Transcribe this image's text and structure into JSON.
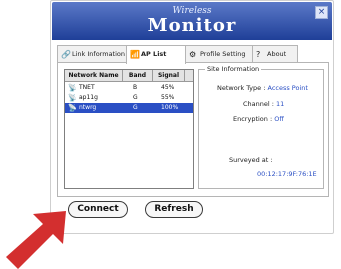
{
  "window": {
    "title_small": "Wireless",
    "title_large": "Monitor",
    "close_glyph": "×"
  },
  "tabs": [
    {
      "label": "Link Information",
      "icon": "link-icon"
    },
    {
      "label": "AP List",
      "icon": "ap-list-icon",
      "active": true
    },
    {
      "label": "Profile Setting",
      "icon": "profile-icon"
    },
    {
      "label": "About",
      "icon": "about-icon"
    }
  ],
  "ap_list": {
    "columns": [
      "Network Name",
      "Band",
      "Signal"
    ],
    "rows": [
      {
        "name": "TNET",
        "band": "B",
        "signal": "45%",
        "selected": false
      },
      {
        "name": "ap11g",
        "band": "G",
        "signal": "55%",
        "selected": false
      },
      {
        "name": "ntwrg",
        "band": "G",
        "signal": "100%",
        "selected": true
      }
    ]
  },
  "site_info": {
    "legend": "Site Information",
    "network_type_label": "Network Type :",
    "network_type_value": "Access Point",
    "channel_label": "Channel :",
    "channel_value": "11",
    "encryption_label": "Encryption :",
    "encryption_value": "Off",
    "surveyed_label": "Surveyed at :",
    "surveyed_value": "00:12:17:9F:76:1E"
  },
  "buttons": {
    "connect": "Connect",
    "refresh": "Refresh"
  },
  "colors": {
    "title_bar": "#1f3f98",
    "selection": "#2a4fc4",
    "arrow": "#d32f2f"
  }
}
